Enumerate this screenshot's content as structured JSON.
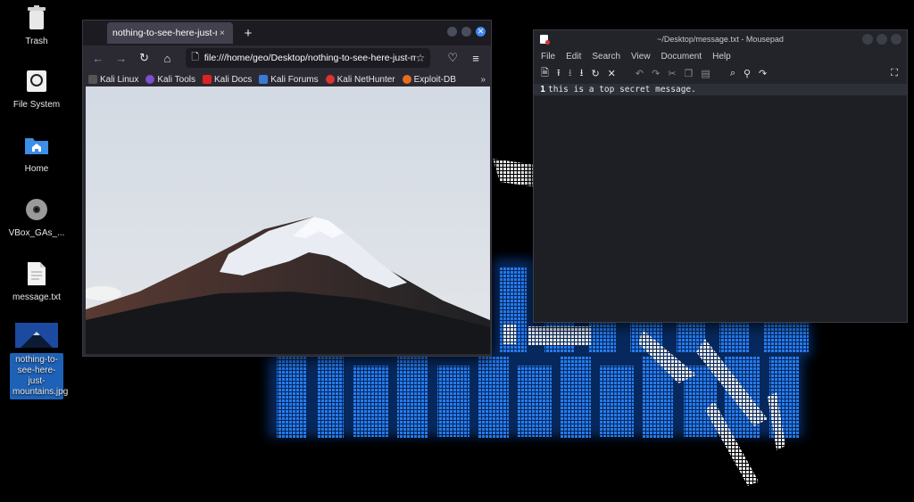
{
  "desktop": {
    "icons": [
      {
        "label": "Trash",
        "icon": "trash-icon"
      },
      {
        "label": "File System",
        "icon": "drive-icon"
      },
      {
        "label": "Home",
        "icon": "home-folder-icon"
      },
      {
        "label": "VBox_GAs_...",
        "icon": "disc-icon"
      },
      {
        "label": "message.txt",
        "icon": "text-file-icon"
      },
      {
        "label": "nothing-to-see-here-just-mountains.jpg",
        "icon": "image-file-icon",
        "selected": true
      }
    ]
  },
  "firefox": {
    "tab_title": "nothing-to-see-here-just-mo",
    "tab_close": "×",
    "new_tab": "+",
    "url": "file:///home/geo/Desktop/nothing-to-see-here-just-m",
    "bookmarks": [
      "Kali Linux",
      "Kali Tools",
      "Kali Docs",
      "Kali Forums",
      "Kali NetHunter",
      "Exploit-DB"
    ],
    "bookmarks_more": "»"
  },
  "mousepad": {
    "title": "~/Desktop/message.txt - Mousepad",
    "menu": [
      "File",
      "Edit",
      "Search",
      "View",
      "Document",
      "Help"
    ],
    "lines": [
      {
        "number": "1",
        "text": "this is a top secret message."
      }
    ]
  },
  "colors": {
    "accent": "#3f86f0",
    "selection": "#1e62b8",
    "wallpaper_glow": "#1f6fd0"
  }
}
